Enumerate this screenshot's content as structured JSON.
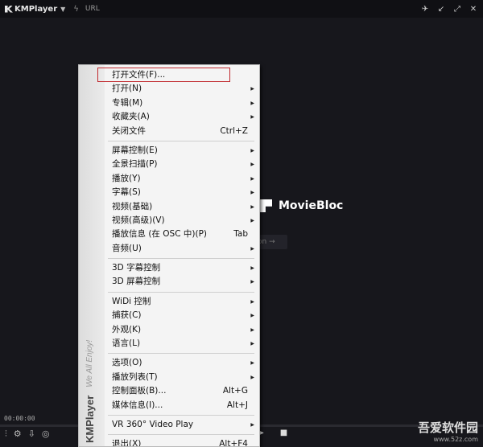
{
  "titlebar": {
    "app_name": "KMPlayer",
    "url_label": "URL"
  },
  "video": {
    "brand": "MovieBloc",
    "button_text": "on →"
  },
  "player": {
    "time": "00:00:00"
  },
  "menu": {
    "side_logo": "KMPlayer",
    "side_slogan": "We All Enjoy!",
    "groups": [
      [
        {
          "label": "打开文件(F)...",
          "shortcut": "",
          "submenu": false
        },
        {
          "label": "打开(N)",
          "shortcut": "",
          "submenu": true
        },
        {
          "label": "专辑(M)",
          "shortcut": "",
          "submenu": true
        },
        {
          "label": "收藏夹(A)",
          "shortcut": "",
          "submenu": true
        },
        {
          "label": "关闭文件",
          "shortcut": "Ctrl+Z",
          "submenu": false
        }
      ],
      [
        {
          "label": "屏幕控制(E)",
          "shortcut": "",
          "submenu": true
        },
        {
          "label": "全景扫描(P)",
          "shortcut": "",
          "submenu": true
        },
        {
          "label": "播放(Y)",
          "shortcut": "",
          "submenu": true
        },
        {
          "label": "字幕(S)",
          "shortcut": "",
          "submenu": true
        },
        {
          "label": "视频(基础)",
          "shortcut": "",
          "submenu": true
        },
        {
          "label": "视频(高级)(V)",
          "shortcut": "",
          "submenu": true
        },
        {
          "label": "播放信息 (在 OSC 中)(P)",
          "shortcut": "Tab",
          "submenu": false
        },
        {
          "label": "音频(U)",
          "shortcut": "",
          "submenu": true
        }
      ],
      [
        {
          "label": "3D 字幕控制",
          "shortcut": "",
          "submenu": true
        },
        {
          "label": "3D 屏幕控制",
          "shortcut": "",
          "submenu": true
        }
      ],
      [
        {
          "label": "WiDi 控制",
          "shortcut": "",
          "submenu": true
        },
        {
          "label": "捕获(C)",
          "shortcut": "",
          "submenu": true
        },
        {
          "label": "外观(K)",
          "shortcut": "",
          "submenu": true
        },
        {
          "label": "语言(L)",
          "shortcut": "",
          "submenu": true
        }
      ],
      [
        {
          "label": "选项(O)",
          "shortcut": "",
          "submenu": true
        },
        {
          "label": "播放列表(T)",
          "shortcut": "",
          "submenu": true
        },
        {
          "label": "控制面板(B)...",
          "shortcut": "Alt+G",
          "submenu": false
        },
        {
          "label": "媒体信息(I)...",
          "shortcut": "Alt+J",
          "submenu": false
        }
      ],
      [
        {
          "label": "VR 360° Video Play",
          "shortcut": "",
          "submenu": true
        }
      ],
      [
        {
          "label": "退出(X)",
          "shortcut": "Alt+F4",
          "submenu": false
        }
      ]
    ]
  },
  "watermark": {
    "line1": "吾爱软件园",
    "line2": "www.52z.com"
  }
}
